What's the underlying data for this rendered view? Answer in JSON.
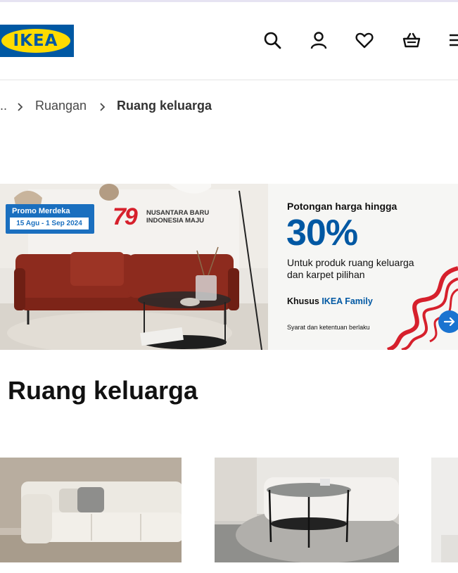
{
  "brand": {
    "logo_text": "IKEA"
  },
  "header": {
    "icons": [
      "search-icon",
      "user-icon",
      "heart-icon",
      "basket-icon",
      "menu-icon"
    ]
  },
  "breadcrumb": {
    "ellipsis": "..",
    "items": [
      "Ruangan",
      "Ruang keluarga"
    ]
  },
  "banner": {
    "promo_title": "Promo Merdeka",
    "promo_dates": "15 Agu - 1 Sep 2024",
    "anniversary_number": "79",
    "anniversary_line1": "NUSANTARA BARU",
    "anniversary_line2": "INDONESIA MAJU",
    "offer_heading": "Potongan harga hingga",
    "offer_percent": "30%",
    "offer_desc": "Untuk produk ruang keluarga dan karpet pilihan",
    "offer_family_prefix": "Khusus",
    "offer_family_name": "IKEA Family",
    "offer_terms": "Syarat dan ketentuan berlaku"
  },
  "page": {
    "title": "Ruang keluarga"
  },
  "colors": {
    "ikea_blue": "#0058a3",
    "ikea_yellow": "#ffdb00",
    "promo_blue": "#1a6fbf",
    "accent_red": "#d6202c"
  }
}
